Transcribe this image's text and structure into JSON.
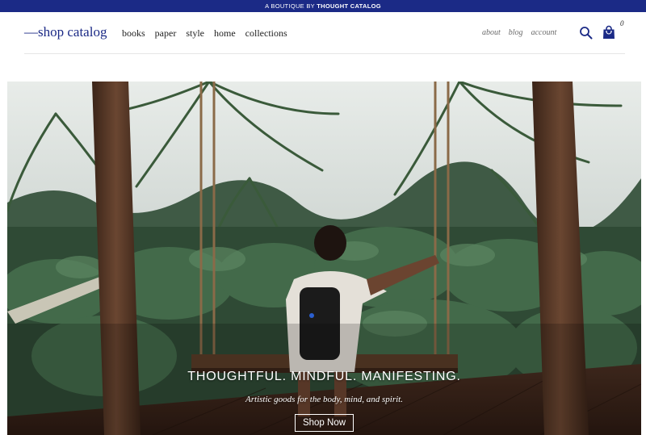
{
  "banner": {
    "prefix": "A BOUTIQUE BY",
    "brand": "THOUGHT CATALOG"
  },
  "header": {
    "logo": "—shop catalog",
    "nav": [
      "books",
      "paper",
      "style",
      "home",
      "collections"
    ],
    "secondary_nav": [
      "about",
      "blog",
      "account"
    ],
    "search_icon": "search-icon",
    "cart_icon": "shopping-bag-icon",
    "cart_count": "0"
  },
  "hero": {
    "headline": "THOUGHTFUL. MINDFUL. MANIFESTING.",
    "subheadline": "Artistic goods for the body, mind, and spirit.",
    "cta_label": "Shop Now"
  },
  "colors": {
    "brand_navy": "#1b2a86",
    "nav_text": "#222222",
    "secondary_nav_text": "#6b6b6b"
  }
}
